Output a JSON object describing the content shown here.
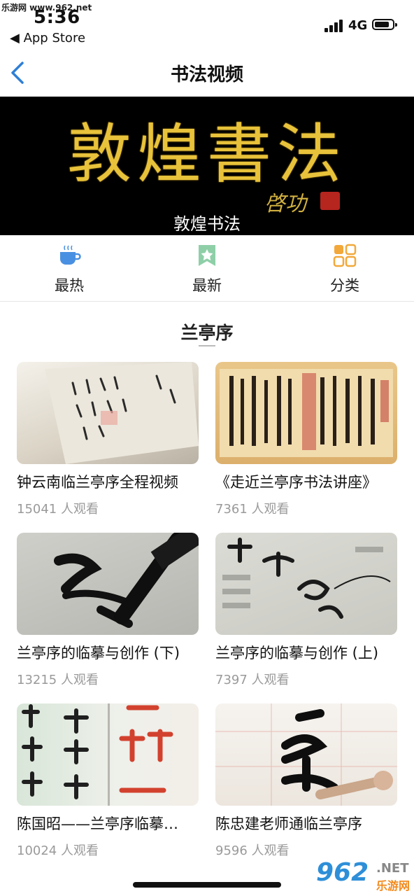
{
  "watermark": {
    "top_text": "乐游网 www.962.net",
    "logo_number": "962",
    "logo_net": ".NET",
    "logo_sub": "乐游网"
  },
  "status": {
    "time": "5:36",
    "back_app": "◀ App Store",
    "network": "4G",
    "battery_level": 0.72
  },
  "nav": {
    "title": "书法视频",
    "back_icon": "chevron-left-icon"
  },
  "banner": {
    "art_text": "敦煌書法",
    "signature": "啓功",
    "caption": "敦煌书法"
  },
  "quick_nav": [
    {
      "label": "最热",
      "icon": "hot-cup-icon",
      "color": "#4a90e2"
    },
    {
      "label": "最新",
      "icon": "star-badge-icon",
      "color": "#6fbf8f"
    },
    {
      "label": "分类",
      "icon": "grid-icon",
      "color": "#f2a83a"
    }
  ],
  "section": {
    "title": "兰亭序"
  },
  "videos": [
    {
      "title": "钟云南临兰亭序全程视频",
      "views": "15041 人观看"
    },
    {
      "title": "《走近兰亭序书法讲座》",
      "views": "7361 人观看"
    },
    {
      "title": "兰亭序的临摹与创作 (下)",
      "views": "13215 人观看"
    },
    {
      "title": "兰亭序的临摹与创作 (上)",
      "views": "7397 人观看"
    },
    {
      "title": "陈国昭——兰亭序临摹…",
      "views": "10024 人观看"
    },
    {
      "title": "陈忠建老师通临兰亭序",
      "views": "9596 人观看"
    }
  ]
}
